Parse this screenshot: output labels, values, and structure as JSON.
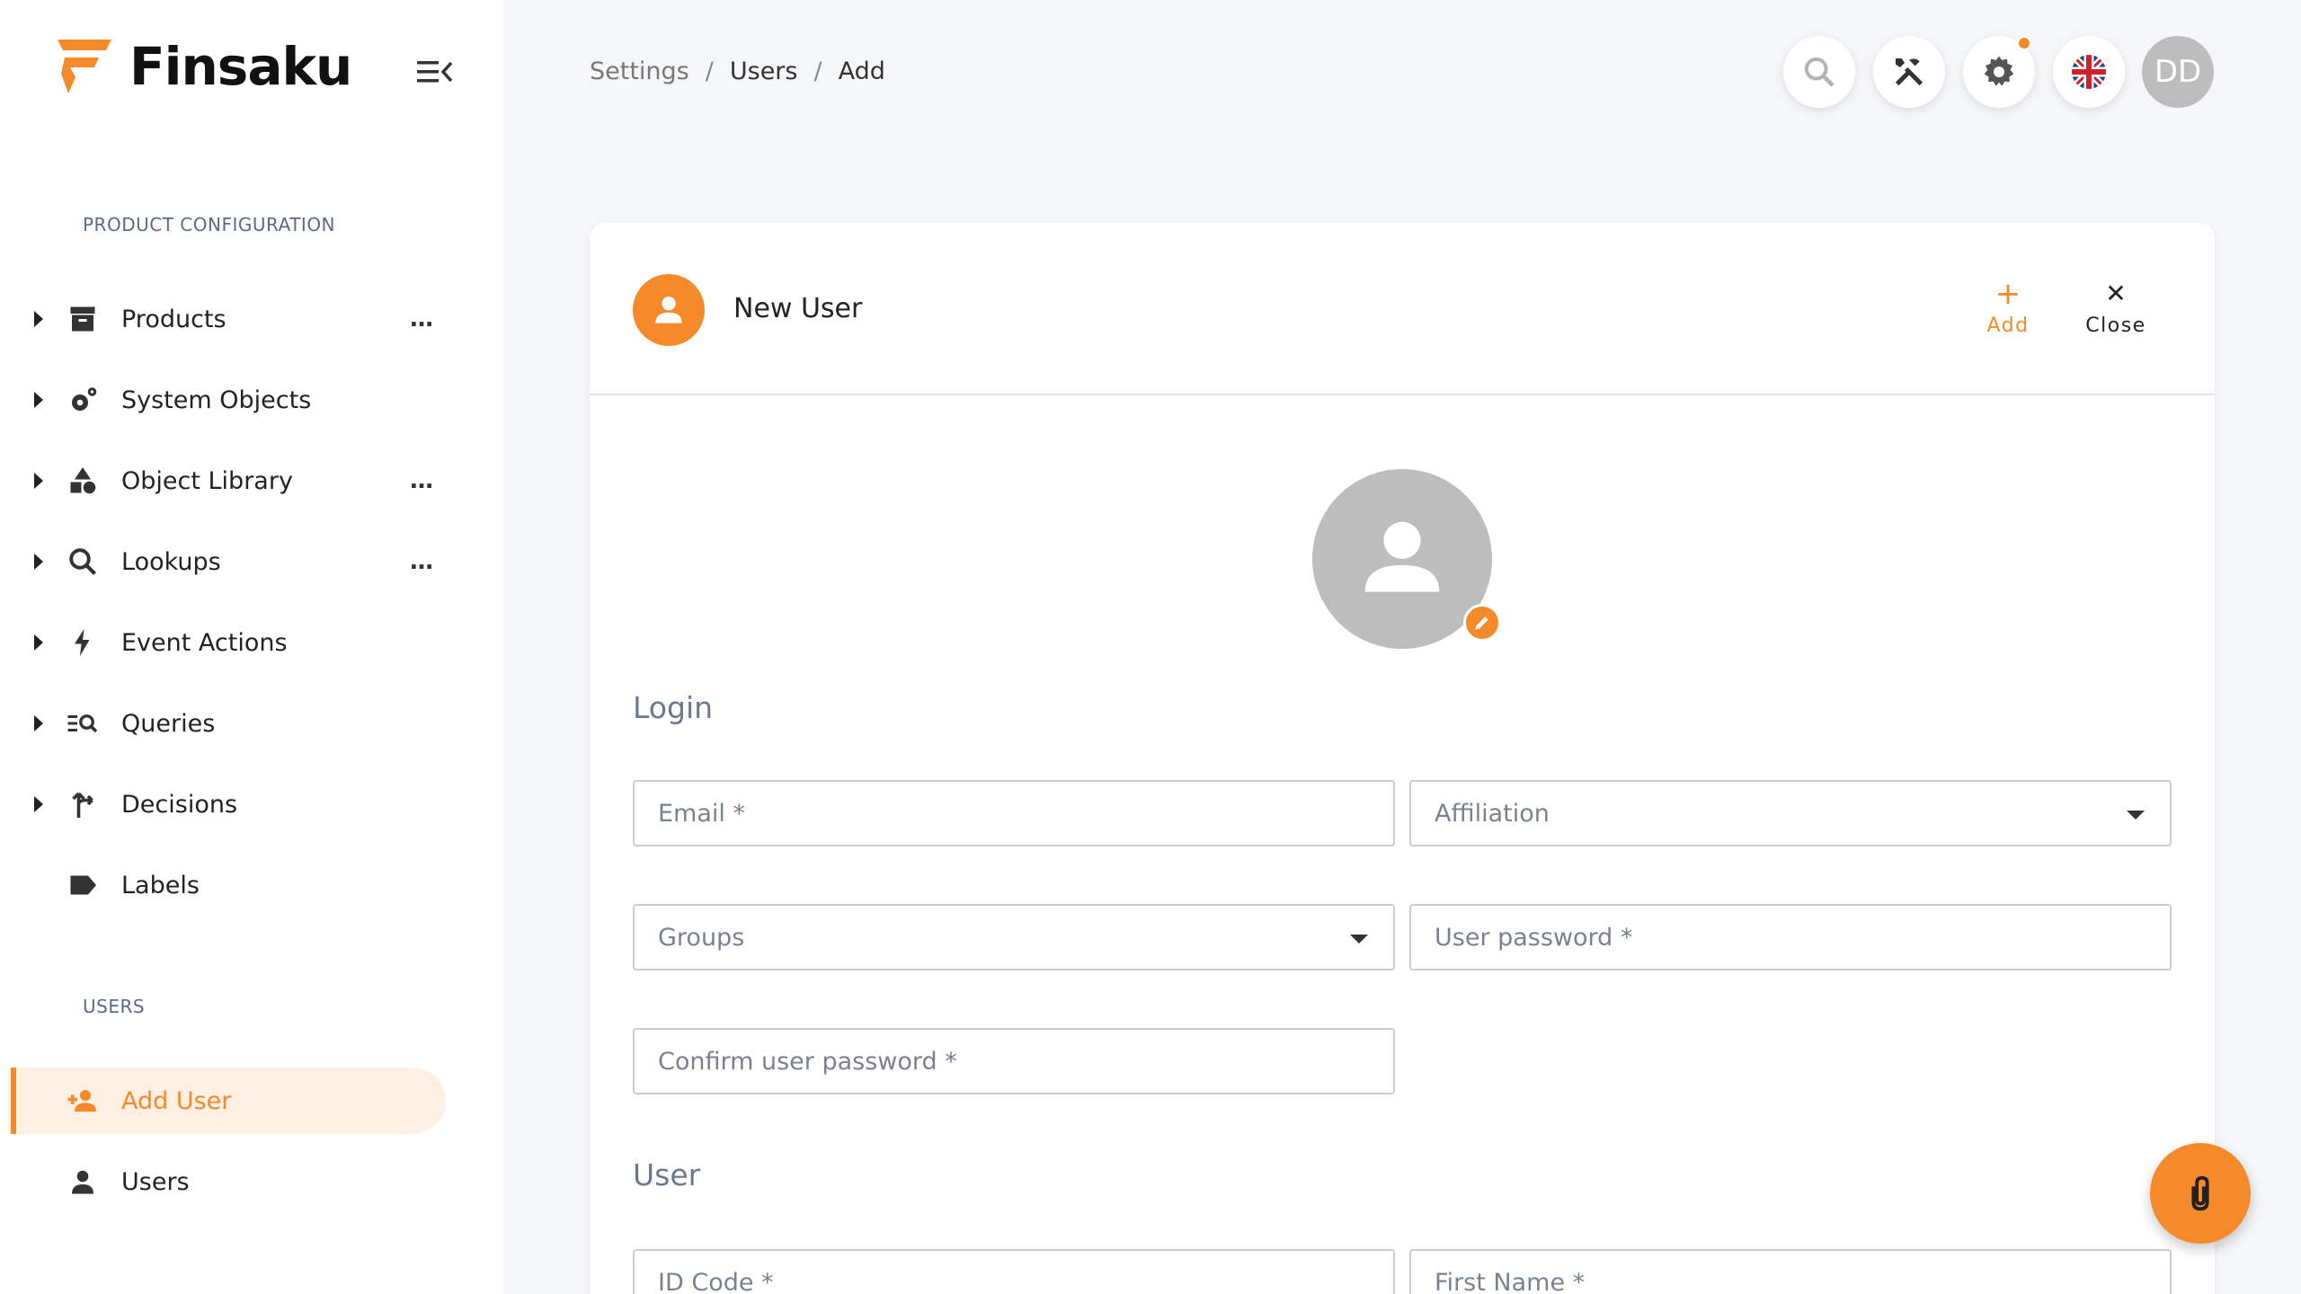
{
  "app": {
    "name": "Finsaku",
    "brand_color": "#f58a2a"
  },
  "sidebar": {
    "sections": [
      {
        "label": "PRODUCT CONFIGURATION"
      },
      {
        "label": "USERS"
      }
    ],
    "config_items": [
      {
        "label": "Products",
        "icon": "archive-icon",
        "has_menu": true
      },
      {
        "label": "System Objects",
        "icon": "gears-icon",
        "has_menu": false
      },
      {
        "label": "Object Library",
        "icon": "shapes-icon",
        "has_menu": true
      },
      {
        "label": "Lookups",
        "icon": "search-icon",
        "has_menu": true
      },
      {
        "label": "Event Actions",
        "icon": "lightning-icon",
        "has_menu": false
      },
      {
        "label": "Queries",
        "icon": "query-icon",
        "has_menu": false
      },
      {
        "label": "Decisions",
        "icon": "fork-icon",
        "has_menu": false
      },
      {
        "label": "Labels",
        "icon": "label-icon",
        "has_menu": false
      }
    ],
    "menu_dots": "…",
    "user_items": [
      {
        "label": "Add User",
        "icon": "add-user-icon",
        "active": true
      },
      {
        "label": "Users",
        "icon": "user-icon",
        "active": false
      }
    ]
  },
  "breadcrumb": {
    "items": [
      "Settings",
      "Users",
      "Add"
    ],
    "separator": "/"
  },
  "topbar": {
    "avatar_initials": "DD"
  },
  "card": {
    "title": "New User",
    "actions": {
      "add": {
        "label": "Add",
        "glyph": "+"
      },
      "close": {
        "label": "Close",
        "glyph": "✕"
      }
    }
  },
  "form": {
    "login_section": "Login",
    "user_section": "User",
    "fields": {
      "email": "Email *",
      "affiliation": "Affiliation",
      "groups": "Groups",
      "user_password": "User password *",
      "confirm_password": "Confirm user password *",
      "id_code": "ID Code *",
      "first_name": "First Name *"
    }
  }
}
